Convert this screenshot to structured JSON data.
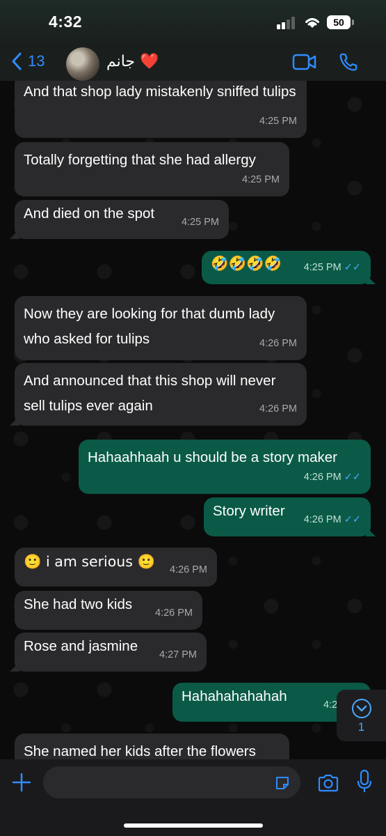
{
  "status_bar": {
    "time": "4:32",
    "battery": "50"
  },
  "header": {
    "back_count": "13",
    "contact_name": "جانم ❤️",
    "icons": [
      "chevron-left-icon",
      "avatar",
      "video-camera-icon",
      "phone-icon"
    ]
  },
  "colors": {
    "accent": "#2f8cff",
    "incoming_bubble": "#2a2a2c",
    "outgoing_bubble": "#0a5a47",
    "read_tick": "#4aa8ff"
  },
  "messages": [
    {
      "dir": "in",
      "text": "And that shop lady mistakenly sniffed tulips",
      "time": "4:25 PM"
    },
    {
      "dir": "in",
      "text": "Totally forgetting that she had allergy",
      "time": "4:25 PM"
    },
    {
      "dir": "in",
      "text": "And died on the spot",
      "time": "4:25 PM"
    },
    {
      "dir": "out",
      "text": "🤣🤣🤣🤣",
      "time": "4:25 PM",
      "read": true
    },
    {
      "dir": "in",
      "text": "Now they are looking for that dumb lady who asked for tulips",
      "time": "4:26 PM"
    },
    {
      "dir": "in",
      "text": "And announced that this shop will never sell tulips ever again",
      "time": "4:26 PM"
    },
    {
      "dir": "out",
      "text": "Hahaahhaah u should be a story maker",
      "time": "4:26 PM",
      "read": true
    },
    {
      "dir": "out",
      "text": "Story writer",
      "time": "4:26 PM",
      "read": true
    },
    {
      "dir": "in",
      "text": "🙂 i am serious 🙂",
      "time": "4:26 PM"
    },
    {
      "dir": "in",
      "text": "She had two kids",
      "time": "4:26 PM"
    },
    {
      "dir": "in",
      "text": "Rose and jasmine",
      "time": "4:27 PM"
    },
    {
      "dir": "out",
      "text": "Hahahahahahah",
      "time": "4:27 PM"
    },
    {
      "dir": "in",
      "text": "She named her kids after the flowers",
      "time": ""
    }
  ],
  "scroll_button": {
    "unread_count": "1"
  },
  "composer": {
    "placeholder": ""
  }
}
